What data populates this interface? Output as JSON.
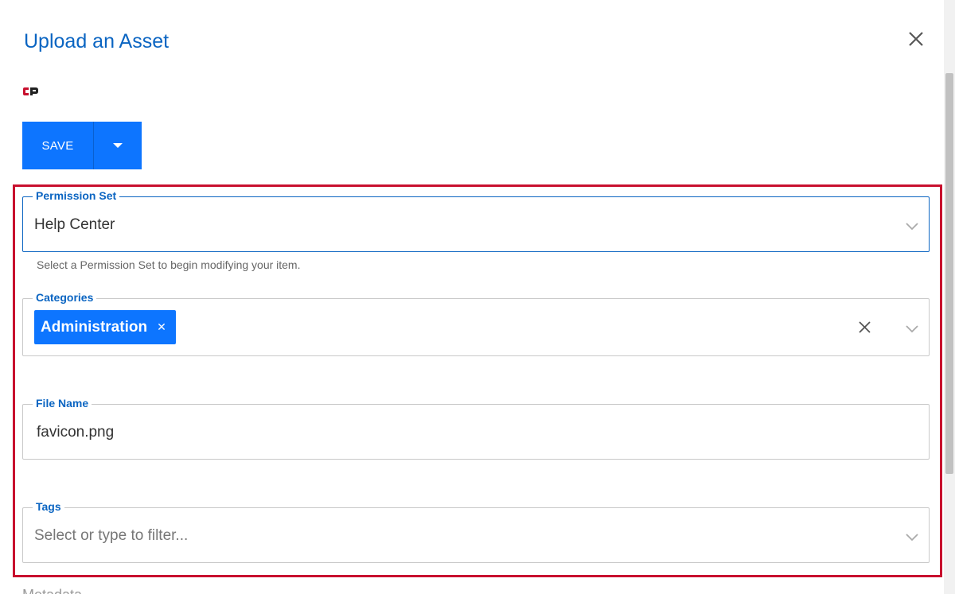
{
  "dialog": {
    "title": "Upload an Asset",
    "close_icon": "close-icon",
    "logo_icon": "cp-logo-icon"
  },
  "toolbar": {
    "save_label": "SAVE",
    "dropdown_icon": "caret-down-icon",
    "button_color": "#0d75ff"
  },
  "form": {
    "permission_set": {
      "label": "Permission Set",
      "value": "Help Center",
      "helper": "Select a Permission Set to begin modifying your item."
    },
    "categories": {
      "label": "Categories",
      "chips": [
        {
          "label": "Administration"
        }
      ]
    },
    "file_name": {
      "label": "File Name",
      "value": "favicon.png"
    },
    "tags": {
      "label": "Tags",
      "placeholder": "Select or type to filter..."
    },
    "next_section_label": "Metadata"
  },
  "colors": {
    "accent": "#0b65c2",
    "highlight_border": "#c8102e"
  }
}
